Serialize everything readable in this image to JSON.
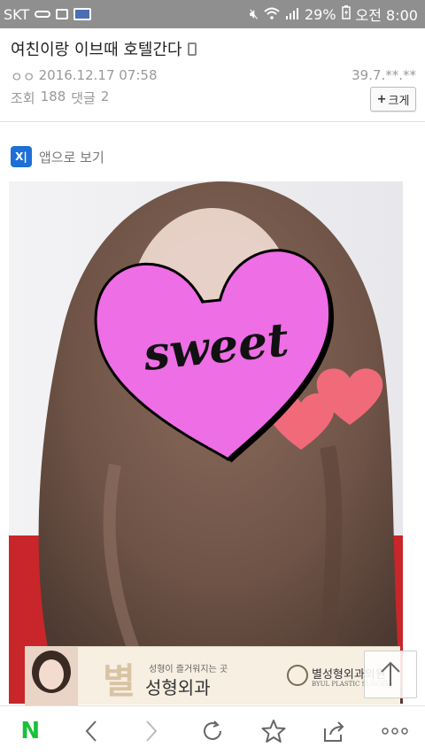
{
  "status_bar": {
    "carrier": "SKT",
    "battery": "29%",
    "time": "오전 8:00"
  },
  "post": {
    "title": "여친이랑 이브때 호텔간다",
    "author_prefix": "ㅇㅇ",
    "datetime": "2016.12.17 07:58",
    "ip": "39.7.**.**",
    "views_label": "조회",
    "views": "188",
    "comments_label": "댓글",
    "comments": "2",
    "size_button": "크게"
  },
  "app_view": {
    "icon_text": "X|",
    "label": "앱으로 보기"
  },
  "photo": {
    "sticker_text": "sweet"
  },
  "ad": {
    "tagline": "성형이 즐거워지는 곳",
    "big_char": "별",
    "name": "성형외과",
    "brand": "별성형외과의원",
    "brand_sub": "BYUL PLASTIC SURGERY"
  },
  "toolbar": {
    "home_label": "N",
    "colors": {
      "naver_green": "#17c23a",
      "heart_pink": "#ee6ee6"
    }
  }
}
